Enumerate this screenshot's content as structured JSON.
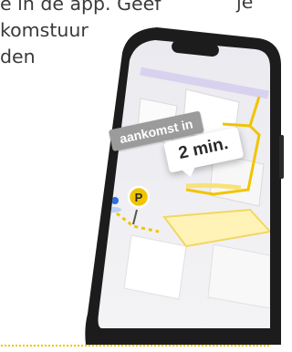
{
  "intro_text": {
    "line1": "e in de app. Geef",
    "line1_right": "je",
    "line2": "komstuur",
    "line3": "den"
  },
  "arrival_bubble": {
    "label": "aankomst in",
    "value": "2 min."
  },
  "colors": {
    "accent_yellow": "#f2c400",
    "phone_frame": "#1c1c1c",
    "user_dot": "#2b6fe0"
  },
  "icons": {
    "destination": "parking-p-pin-icon",
    "user": "location-dot-icon"
  }
}
